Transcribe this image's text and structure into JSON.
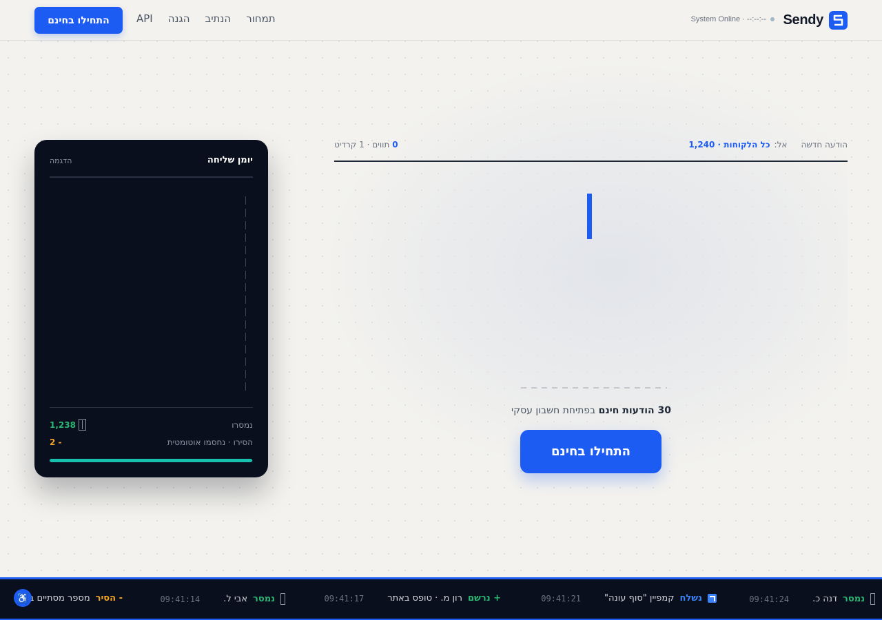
{
  "header": {
    "logo_text": "Sendy",
    "status_text": "System Online · --:--:--",
    "nav": [
      "תמחור",
      "הנתיב",
      "הגנה",
      "API"
    ],
    "cta_label": "התחילו בחינם"
  },
  "composer": {
    "label": "הודעה חדשה",
    "to_prefix": "אל:",
    "to_value": "כל הלקוחות · 1,240",
    "char_count": "0",
    "char_meta": "תווים · 1 קרדיט",
    "offer_bold": "30 הודעות חינם",
    "offer_rest": "בפתיחת חשבון עסקי",
    "cta_label": "התחילו בחינם"
  },
  "log_card": {
    "title": "יומן שליחה",
    "tag": "הדגמה",
    "delivered_label": "נמסרו",
    "delivered_value": "1,238",
    "rejected_label": "הסירו · נחסמו אוטומטית",
    "rejected_value": "2 -",
    "progress_fraction": 0.998,
    "colors": {
      "green": "#2bb673",
      "amber": "#f5a524",
      "progress": "#18c1ad"
    }
  },
  "ticker": {
    "items": [
      {
        "status": "נמסר",
        "text": "דנה כ.",
        "time": "09:41:24",
        "tone": "green",
        "icon": "box-icon"
      },
      {
        "status": "נשלח",
        "text": "קמפיין \"סוף עונה\"",
        "time": "09:41:21",
        "tone": "blue",
        "icon": "send-icon"
      },
      {
        "status": "+ נרשם",
        "text": "רון מ. · טופס באתר",
        "time": "09:41:17",
        "tone": "green",
        "icon": ""
      },
      {
        "status": "נמסר",
        "text": "אבי ל.",
        "time": "09:41:14",
        "tone": "green",
        "icon": "box-icon"
      },
      {
        "status": "- הסיר",
        "text": "מספר מסתיים ב-",
        "time": "",
        "tone": "amber",
        "icon": ""
      }
    ]
  },
  "accessibility_icon": "accessibility-icon",
  "brand_color": "#1d5cf3"
}
